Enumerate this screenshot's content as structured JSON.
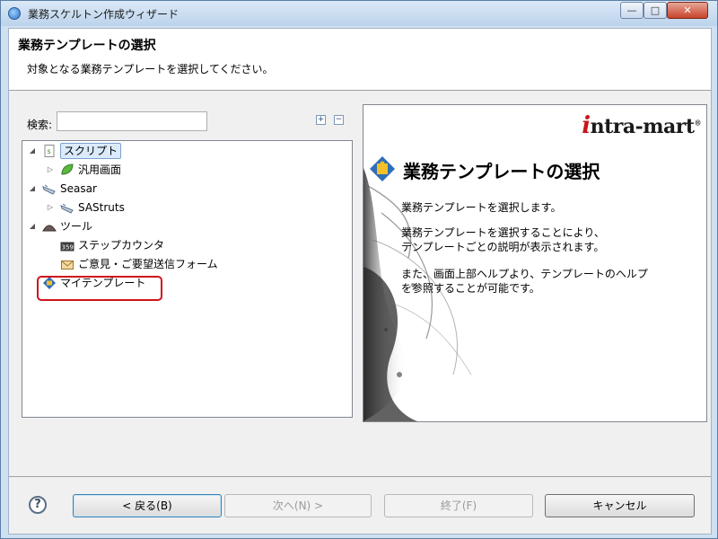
{
  "window": {
    "title": "業務スケルトン作成ウィザード",
    "controls": {
      "minimize": "—",
      "maximize": "□",
      "close": "✕"
    }
  },
  "header": {
    "title": "業務テンプレートの選択",
    "description": "対象となる業務テンプレートを選択してください。"
  },
  "search": {
    "label": "検索:",
    "value": "",
    "placeholder": ""
  },
  "tree_tools": {
    "expand": "+",
    "collapse": "−"
  },
  "tree": {
    "items": [
      {
        "label": "スクリプト"
      },
      {
        "label": "汎用画面"
      },
      {
        "label": "Seasar"
      },
      {
        "label": "SAStruts"
      },
      {
        "label": "ツール"
      },
      {
        "label": "ステップカウンタ"
      },
      {
        "label": "ご意見・ご要望送信フォーム"
      },
      {
        "label": "マイテンプレート"
      }
    ]
  },
  "preview": {
    "logo_prefix": "i",
    "logo_rest": "ntra-mart",
    "logo_mark": "®",
    "title": "業務テンプレートの選択",
    "p1": "業務テンプレートを選択します。",
    "p2_line1": "業務テンプレートを選択することにより、",
    "p2_line2": "テンプレートごとの説明が表示されます。",
    "p3_line1": "また、画面上部ヘルプより、テンプレートのヘルプ",
    "p3_line2": "を参照することが可能です。"
  },
  "footer": {
    "help": "?",
    "back": "< 戻る(B)",
    "next": "次へ(N) >",
    "finish": "終了(F)",
    "cancel": "キャンセル"
  },
  "colors": {
    "highlight": "#d0131b",
    "selection": "#dcebfc",
    "logo_red": "#c8151b"
  }
}
